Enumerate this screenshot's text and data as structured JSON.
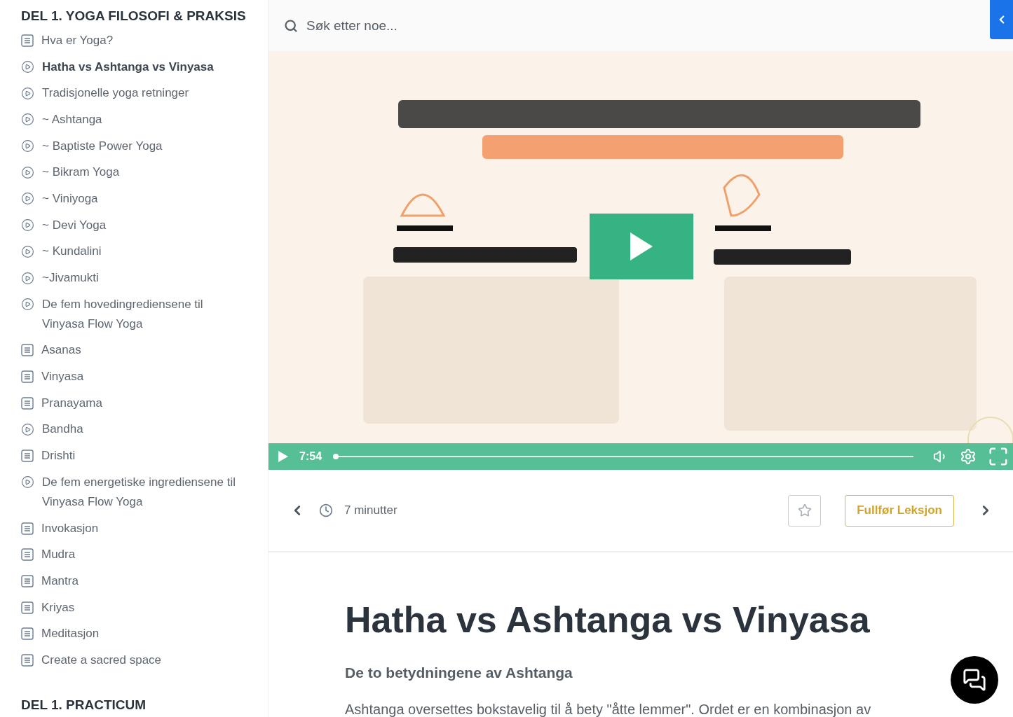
{
  "sidebar": {
    "sections": [
      {
        "title": "DEL 1. YOGA FILOSOFI & PRAKSIS",
        "items": [
          {
            "label": "Hva er Yoga?",
            "kind": "text",
            "selected": false
          },
          {
            "label": "Hatha vs Ashtanga vs Vinyasa",
            "kind": "video",
            "selected": true
          },
          {
            "label": "Tradisjonelle yoga retninger",
            "kind": "video",
            "selected": false
          },
          {
            "label": "~ Ashtanga",
            "kind": "video",
            "selected": false
          },
          {
            "label": "~ Baptiste Power Yoga",
            "kind": "video",
            "selected": false
          },
          {
            "label": "~ Bikram Yoga",
            "kind": "video",
            "selected": false
          },
          {
            "label": "~ Viniyoga",
            "kind": "video",
            "selected": false
          },
          {
            "label": "~ Devi Yoga",
            "kind": "video",
            "selected": false
          },
          {
            "label": "~ Kundalini",
            "kind": "video",
            "selected": false
          },
          {
            "label": "~Jivamukti",
            "kind": "video",
            "selected": false
          },
          {
            "label": "De fem hovedingrediensene til Vinyasa Flow Yoga",
            "kind": "video",
            "selected": false
          },
          {
            "label": "Asanas",
            "kind": "text",
            "selected": false
          },
          {
            "label": "Vinyasa",
            "kind": "text",
            "selected": false
          },
          {
            "label": "Pranayama",
            "kind": "text",
            "selected": false
          },
          {
            "label": "Bandha",
            "kind": "video",
            "selected": false
          },
          {
            "label": "Drishti",
            "kind": "text",
            "selected": false
          },
          {
            "label": "De fem energetiske ingrediensene til Vinyasa Flow Yoga",
            "kind": "video",
            "selected": false
          },
          {
            "label": "Invokasjon",
            "kind": "text",
            "selected": false
          },
          {
            "label": "Mudra",
            "kind": "text",
            "selected": false
          },
          {
            "label": "Mantra",
            "kind": "text",
            "selected": false
          },
          {
            "label": "Kriyas",
            "kind": "text",
            "selected": false
          },
          {
            "label": "Meditasjon",
            "kind": "text",
            "selected": false
          },
          {
            "label": "Create a sacred space",
            "kind": "text",
            "selected": false
          }
        ]
      },
      {
        "title": "DEL 1. PRACTICUM"
      }
    ]
  },
  "search": {
    "placeholder": "Søk etter noe..."
  },
  "video": {
    "kind": "picture",
    "time": "7:54",
    "level": 0
  },
  "lesson": {
    "duration": "7 minutter",
    "favorite": false,
    "complete_button": "Fullfør Leksjon"
  },
  "article": {
    "title": "Hatha vs Ashtanga vs Vinyasa",
    "subtitle": "De to betydningene av Ashtanga",
    "paragraph": "Ashtanga oversettes bokstavelig til å bety \"åtte lemmer\". Ordet er en kombinasjon av"
  }
}
